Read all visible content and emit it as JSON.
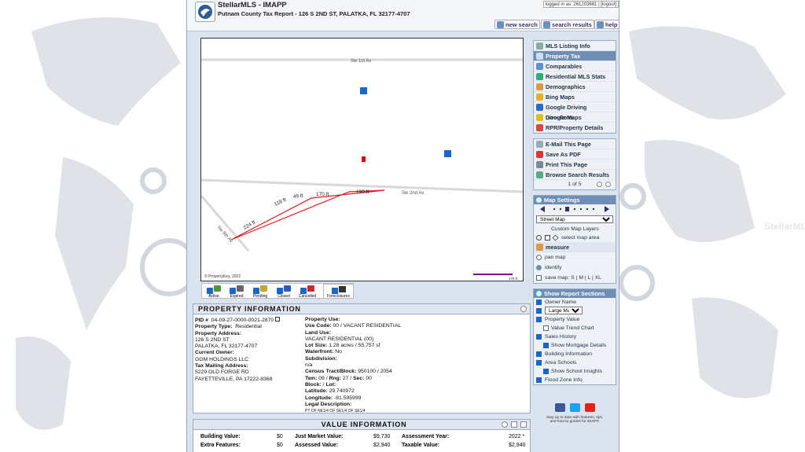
{
  "header": {
    "title": "StellarMLS - IMAPP",
    "subtitle": "Putnam County Tax Report - 126 S 2ND ST, PALATKA, FL 32177-4707",
    "login_text": "logged in as: 261203681 |",
    "logout": "logout",
    "new_search": "new search",
    "search_results": "search results",
    "help": "help"
  },
  "map": {
    "streets": [
      "Sw 1st Av",
      "Sw 2nd Av",
      "Sw 8th Av"
    ],
    "dims": [
      "49 ft",
      "170 ft",
      "190 ft",
      "118 ft",
      "224 ft"
    ],
    "copyright": "© PropertyKey, 2022",
    "scale": "178 ft"
  },
  "legend": {
    "active": "Active",
    "expired": "Expired",
    "pending": "Pending",
    "closed": "Closed",
    "cancelled": "Cancelled",
    "foreclosures": "Foreclosures"
  },
  "menu": {
    "items": [
      "MLS Listing Info",
      "Property Tax",
      "Comparables",
      "Residential MLS Stats",
      "Demographics",
      "Bing Maps",
      "Google Driving Directions",
      "Google Maps",
      "RPR/Property Details"
    ],
    "actions": [
      "E-Mail This Page",
      "Save As PDF",
      "Print This Page",
      "Browse Search Results"
    ],
    "pagination": "1 of 5"
  },
  "map_settings": {
    "title": "Map Settings",
    "street_map": "Street Map",
    "custom_layers": "Custom Map Layers",
    "select_area": "select map area",
    "measure": "measure",
    "pan": "pan map",
    "identify": "identify",
    "save_map": "save map:",
    "save_sizes": "S | M | L | XL"
  },
  "report_sections": {
    "title": "Show Report Sections",
    "owner_name": "Owner Name",
    "map_size": "Large Map",
    "property_value": "Property Value",
    "value_trend": "Value Trend Chart",
    "sales_history": "Sales History",
    "mortgage": "Show Mortgage Details",
    "building_info": "Building Information",
    "area_schools": "Area Schools",
    "school_insights": "Show School Insights",
    "flood_zone": "Flood Zone Info"
  },
  "social": {
    "text1": "Stay up to date with features, tips,",
    "text2": "and how-to guides for iMAPP."
  },
  "property": {
    "title": "PROPERTY INFORMATION",
    "pid_label": "PID #",
    "pid": "04-09-27-0000-0021-2870",
    "type_label": "Property Type:",
    "type": "Residential",
    "addr_label": "Property Address:",
    "addr1": "126 S 2ND ST",
    "addr2": "PALATKA, FL 32177-4707",
    "owner_label": "Current Owner:",
    "owner": "GGM HOLDINGS LLC",
    "mail_label": "Tax Mailing Address:",
    "mail1": "5229 OLD FORGE RD",
    "mail2": "FAYETTEVILLE, PA 17222-8368",
    "use_label": "Property Use:",
    "usecode_label": "Use Code:",
    "usecode": "00 / VACANT RESIDENTIAL",
    "landuse_label": "Land Use:",
    "landuse": "VACANT RESIDENTIAL (00)",
    "lot_label": "Lot Size:",
    "lot": "1.28 acres / 55,757 sf",
    "water_label": "Waterfront:",
    "water": "No",
    "subdiv_label": "Subdivision:",
    "subdiv": "n/a",
    "census_label": "Census Tract/Block:",
    "census": "950100 / 2054",
    "twn_label": "Twn:",
    "twn": "09",
    "rng_label": "Rng:",
    "rng": "27",
    "sec_label": "Sec:",
    "sec": "00",
    "block_label": "Block:",
    "lotlab": "Lot:",
    "lat_label": "Latitude:",
    "lat": "29.740972",
    "lon_label": "Longitude:",
    "lon": "-81.595999",
    "legal_label": "Legal Description:",
    "legal": "PT OF NE1/4 OF SE1/4 OF SE1/4"
  },
  "value": {
    "title": "VALUE INFORMATION",
    "bldg_label": "Building Value:",
    "bldg": "$0",
    "extra_label": "Extra Features:",
    "extra": "$0",
    "jmv_label": "Just Market Value:",
    "jmv": "$9,730",
    "assessed_label": "Assessed Value:",
    "assessed": "$2,940",
    "ay_label": "Assessment Year:",
    "ay": "2022 *",
    "taxable_label": "Taxable Value:",
    "taxable": "$2,940"
  },
  "colors": {
    "accent": "#6e8eb5",
    "parcel": "#e01b1b",
    "checkbox": "#1b66c9"
  }
}
